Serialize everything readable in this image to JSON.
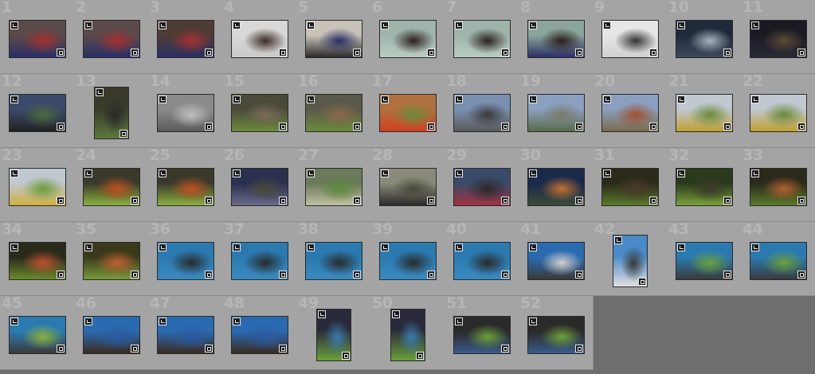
{
  "grid": {
    "columns": 11,
    "cells": [
      {
        "number": "1",
        "orientation": "landscape",
        "palette": [
          "#5a4a4a",
          "#2b2f66",
          "#a33030"
        ]
      },
      {
        "number": "2",
        "orientation": "landscape",
        "palette": [
          "#5a4a4a",
          "#2b2f66",
          "#a33030"
        ]
      },
      {
        "number": "3",
        "orientation": "landscape",
        "palette": [
          "#4d3c35",
          "#2b2f66",
          "#a33030"
        ]
      },
      {
        "number": "4",
        "orientation": "landscape",
        "palette": [
          "#d8d8d8",
          "#c9c9c9",
          "#3a2a22"
        ]
      },
      {
        "number": "5",
        "orientation": "landscape",
        "palette": [
          "#c8c2b8",
          "#2a2a2a",
          "#2b2f66"
        ]
      },
      {
        "number": "6",
        "orientation": "landscape",
        "palette": [
          "#9fb5ac",
          "#b8cbc1",
          "#2a201c"
        ]
      },
      {
        "number": "7",
        "orientation": "landscape",
        "palette": [
          "#9fb5ac",
          "#b8cbc1",
          "#2a201c"
        ]
      },
      {
        "number": "8",
        "orientation": "landscape",
        "palette": [
          "#8aa59b",
          "#2b2f66",
          "#2a201c"
        ]
      },
      {
        "number": "9",
        "orientation": "landscape",
        "palette": [
          "#e6e6e6",
          "#d0d0d0",
          "#333333"
        ]
      },
      {
        "number": "10",
        "orientation": "landscape",
        "palette": [
          "#1f2a3a",
          "#3c4a5c",
          "#aab3bd"
        ]
      },
      {
        "number": "11",
        "orientation": "landscape",
        "palette": [
          "#1b1a22",
          "#2a2a36",
          "#5a4a36"
        ]
      },
      {
        "number": "12",
        "orientation": "landscape",
        "palette": [
          "#3a4a6a",
          "#222222",
          "#4a6a3a"
        ]
      },
      {
        "number": "13",
        "orientation": "portrait",
        "palette": [
          "#3a3a2a",
          "#5a7a3a",
          "#2a2a2a"
        ]
      },
      {
        "number": "14",
        "orientation": "landscape",
        "palette": [
          "#8a8a8a",
          "#5a5a5a",
          "#c0c0c0"
        ]
      },
      {
        "number": "15",
        "orientation": "landscape",
        "palette": [
          "#4a4a3a",
          "#6a8a3a",
          "#7a6a5a"
        ]
      },
      {
        "number": "16",
        "orientation": "landscape",
        "palette": [
          "#5a5a4a",
          "#6a8a3a",
          "#8a6a4a"
        ]
      },
      {
        "number": "17",
        "orientation": "landscape",
        "palette": [
          "#b07040",
          "#d04020",
          "#6a8a3a"
        ]
      },
      {
        "number": "18",
        "orientation": "landscape",
        "palette": [
          "#7a90b0",
          "#5a5a5a",
          "#3a3a3a"
        ]
      },
      {
        "number": "19",
        "orientation": "landscape",
        "palette": [
          "#8aa0c0",
          "#5a6a4a",
          "#7a7a6a"
        ]
      },
      {
        "number": "20",
        "orientation": "landscape",
        "palette": [
          "#8aa0c0",
          "#7a6a4a",
          "#a05030"
        ]
      },
      {
        "number": "21",
        "orientation": "landscape",
        "palette": [
          "#c0c8d0",
          "#c0a030",
          "#6a8a3a"
        ]
      },
      {
        "number": "22",
        "orientation": "landscape",
        "palette": [
          "#c0c8d0",
          "#c0a030",
          "#6a8a3a"
        ]
      },
      {
        "number": "23",
        "orientation": "landscape",
        "palette": [
          "#c0c8d0",
          "#d0b040",
          "#6a9a3a"
        ]
      },
      {
        "number": "24",
        "orientation": "landscape",
        "palette": [
          "#3a3a2a",
          "#8ab040",
          "#c05020"
        ]
      },
      {
        "number": "25",
        "orientation": "landscape",
        "palette": [
          "#3a3a2a",
          "#8ab040",
          "#c05020"
        ]
      },
      {
        "number": "26",
        "orientation": "landscape",
        "palette": [
          "#2a3050",
          "#6a6a8a",
          "#4a4a3a"
        ]
      },
      {
        "number": "27",
        "orientation": "landscape",
        "palette": [
          "#6a7a5a",
          "#c0c0a0",
          "#5a8a3a"
        ]
      },
      {
        "number": "28",
        "orientation": "landscape",
        "palette": [
          "#8a8a7a",
          "#2a2a2a",
          "#4a4a3a"
        ]
      },
      {
        "number": "29",
        "orientation": "landscape",
        "palette": [
          "#3a4a6a",
          "#a03040",
          "#2a2a2a"
        ]
      },
      {
        "number": "30",
        "orientation": "landscape",
        "palette": [
          "#1a2a4a",
          "#3a4a3a",
          "#c07030"
        ]
      },
      {
        "number": "31",
        "orientation": "landscape",
        "palette": [
          "#2a2a1a",
          "#5a7a2a",
          "#4a3a2a"
        ]
      },
      {
        "number": "32",
        "orientation": "landscape",
        "palette": [
          "#2a3a1a",
          "#7aa03a",
          "#3a3a2a"
        ]
      },
      {
        "number": "33",
        "orientation": "landscape",
        "palette": [
          "#2a2a1a",
          "#5a7a2a",
          "#b06030"
        ]
      },
      {
        "number": "34",
        "orientation": "landscape",
        "palette": [
          "#2a2a1a",
          "#6a8a2a",
          "#c05030"
        ]
      },
      {
        "number": "35",
        "orientation": "landscape",
        "palette": [
          "#3a3a1a",
          "#7a9a3a",
          "#c06030"
        ]
      },
      {
        "number": "36",
        "orientation": "landscape",
        "palette": [
          "#2a7ab0",
          "#3a8ac0",
          "#2a2a2a"
        ]
      },
      {
        "number": "37",
        "orientation": "landscape",
        "palette": [
          "#2a7ab0",
          "#3a8ac0",
          "#2a2a2a"
        ]
      },
      {
        "number": "38",
        "orientation": "landscape",
        "palette": [
          "#2a7ab0",
          "#3a8ac0",
          "#2a2a2a"
        ]
      },
      {
        "number": "39",
        "orientation": "landscape",
        "palette": [
          "#2a7ab0",
          "#3a8ac0",
          "#2a2a2a"
        ]
      },
      {
        "number": "40",
        "orientation": "landscape",
        "palette": [
          "#2a7ab0",
          "#3a8ac0",
          "#2a2a2a"
        ]
      },
      {
        "number": "41",
        "orientation": "landscape",
        "palette": [
          "#2a6ab0",
          "#3a3a3a",
          "#d0d0d0"
        ]
      },
      {
        "number": "42",
        "orientation": "portrait",
        "palette": [
          "#4a8ac8",
          "#e0e0e0",
          "#3a3a3a"
        ]
      },
      {
        "number": "43",
        "orientation": "landscape",
        "palette": [
          "#2a7ab0",
          "#3a3a3a",
          "#6aa03a"
        ]
      },
      {
        "number": "44",
        "orientation": "landscape",
        "palette": [
          "#2a7ab0",
          "#3a3a3a",
          "#6aa03a"
        ]
      },
      {
        "number": "45",
        "orientation": "landscape",
        "palette": [
          "#2a7ab0",
          "#3a3a3a",
          "#8ab03a"
        ]
      },
      {
        "number": "46",
        "orientation": "landscape",
        "palette": [
          "#2a6ab0",
          "#3a2a22",
          "#2a5aa0"
        ]
      },
      {
        "number": "47",
        "orientation": "landscape",
        "palette": [
          "#2a6ab0",
          "#3a2a22",
          "#2a5aa0"
        ]
      },
      {
        "number": "48",
        "orientation": "landscape",
        "palette": [
          "#2a6ab0",
          "#3a2a22",
          "#2a5aa0"
        ]
      },
      {
        "number": "49",
        "orientation": "portrait",
        "palette": [
          "#2a2a3a",
          "#6aa03a",
          "#3a7ab0"
        ]
      },
      {
        "number": "50",
        "orientation": "portrait",
        "palette": [
          "#2a2a3a",
          "#6aa03a",
          "#3a7ab0"
        ]
      },
      {
        "number": "51",
        "orientation": "landscape",
        "palette": [
          "#2a2a2a",
          "#3a5a8a",
          "#6aa03a"
        ]
      },
      {
        "number": "52",
        "orientation": "landscape",
        "palette": [
          "#2a2a2a",
          "#3a5a8a",
          "#6aa03a"
        ]
      }
    ]
  }
}
